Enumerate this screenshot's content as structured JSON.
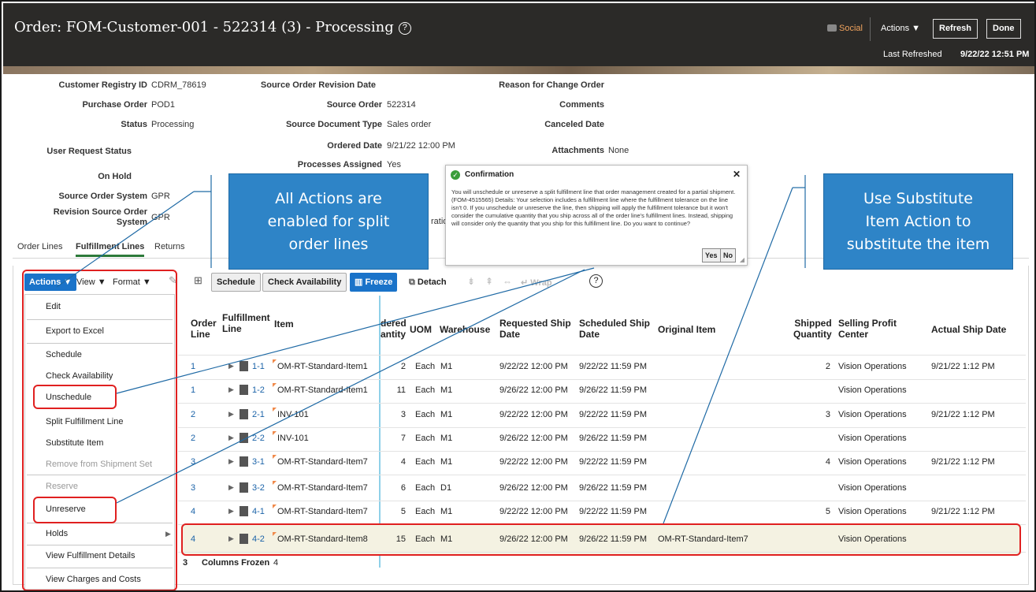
{
  "header": {
    "title": "Order: FOM-Customer-001 - 522314 (3) - Processing",
    "social_label": "Social",
    "actions_label": "Actions ▼",
    "refresh_label": "Refresh",
    "done_label": "Done",
    "last_refreshed_label": "Last Refreshed",
    "last_refreshed_value": "9/22/22 12:51 PM"
  },
  "details": {
    "customer_registry_id_label": "Customer Registry ID",
    "customer_registry_id": "CDRM_78619",
    "purchase_order_label": "Purchase Order",
    "purchase_order": "POD1",
    "status_label": "Status",
    "status": "Processing",
    "user_request_status_label": "User Request Status",
    "on_hold_label": "On Hold",
    "source_order_system_label": "Source Order System",
    "source_order_system": "GPR",
    "revision_source_order_system_label_1": "Revision Source Order",
    "revision_source_order_system_label_2": "System",
    "revision_source_order_system": "GPR",
    "source_order_revision_date_label": "Source Order Revision Date",
    "source_order_label": "Source Order",
    "source_order": "522314",
    "source_document_type_label": "Source Document Type",
    "source_document_type": "Sales order",
    "ordered_date_label": "Ordered Date",
    "ordered_date": "9/21/22 12:00 PM",
    "processes_assigned_label": "Processes Assigned",
    "processes_assigned": "Yes",
    "reason_for_change_order_label": "Reason for Change Order",
    "comments_label": "Comments",
    "canceled_date_label": "Canceled Date",
    "attachments_label": "Attachments",
    "attachments": "None"
  },
  "tabs": [
    "Order Lines",
    "Fulfillment Lines",
    "Returns"
  ],
  "toolbar": {
    "actions": "Actions ▼",
    "view": "View ▼",
    "format": "Format ▼",
    "schedule": "Schedule",
    "check_availability": "Check Availability",
    "freeze": "Freeze",
    "detach": "Detach",
    "wrap": "Wrap"
  },
  "table": {
    "headers": {
      "order_line": [
        "Order",
        "Line"
      ],
      "fulfillment_line": [
        "Fulfillment",
        "Line"
      ],
      "item": "Item",
      "ordered_quantity": [
        "dered",
        "antity"
      ],
      "uom": "UOM",
      "warehouse": "Warehouse",
      "requested_ship_date": [
        "Requested Ship",
        "Date"
      ],
      "scheduled_ship_date": [
        "Scheduled Ship",
        "Date"
      ],
      "original_item": "Original Item",
      "shipped_quantity": [
        "Shipped",
        "Quantity"
      ],
      "selling_profit_center": [
        "Selling Profit",
        "Center"
      ],
      "actual_ship_date": "Actual Ship Date"
    },
    "rows": [
      {
        "order_line": "1",
        "fline": "1-1",
        "item": "OM-RT-Standard-Item1",
        "qty": "2",
        "uom": "Each",
        "wh": "M1",
        "req": "9/22/22 12:00 PM",
        "sched": "9/22/22 11:59 PM",
        "orig": "",
        "shipped": "2",
        "spc": "Vision Operations",
        "actual": "9/21/22 1:12 PM"
      },
      {
        "order_line": "1",
        "fline": "1-2",
        "item": "OM-RT-Standard-Item1",
        "qty": "11",
        "uom": "Each",
        "wh": "M1",
        "req": "9/26/22 12:00 PM",
        "sched": "9/26/22 11:59 PM",
        "orig": "",
        "shipped": "",
        "spc": "Vision Operations",
        "actual": ""
      },
      {
        "order_line": "2",
        "fline": "2-1",
        "item": "INV-101",
        "qty": "3",
        "uom": "Each",
        "wh": "M1",
        "req": "9/22/22 12:00 PM",
        "sched": "9/22/22 11:59 PM",
        "orig": "",
        "shipped": "3",
        "spc": "Vision Operations",
        "actual": "9/21/22 1:12 PM"
      },
      {
        "order_line": "2",
        "fline": "2-2",
        "item": "INV-101",
        "qty": "7",
        "uom": "Each",
        "wh": "M1",
        "req": "9/26/22 12:00 PM",
        "sched": "9/26/22 11:59 PM",
        "orig": "",
        "shipped": "",
        "spc": "Vision Operations",
        "actual": ""
      },
      {
        "order_line": "3",
        "fline": "3-1",
        "item": "OM-RT-Standard-Item7",
        "qty": "4",
        "uom": "Each",
        "wh": "M1",
        "req": "9/22/22 12:00 PM",
        "sched": "9/22/22 11:59 PM",
        "orig": "",
        "shipped": "4",
        "spc": "Vision Operations",
        "actual": "9/21/22 1:12 PM"
      },
      {
        "order_line": "3",
        "fline": "3-2",
        "item": "OM-RT-Standard-Item7",
        "qty": "6",
        "uom": "Each",
        "wh": "D1",
        "req": "9/26/22 12:00 PM",
        "sched": "9/26/22 11:59 PM",
        "orig": "",
        "shipped": "",
        "spc": "Vision Operations",
        "actual": ""
      },
      {
        "order_line": "4",
        "fline": "4-1",
        "item": "OM-RT-Standard-Item7",
        "qty": "5",
        "uom": "Each",
        "wh": "M1",
        "req": "9/22/22 12:00 PM",
        "sched": "9/22/22 11:59 PM",
        "orig": "",
        "shipped": "5",
        "spc": "Vision Operations",
        "actual": "9/21/22 1:12 PM"
      },
      {
        "order_line": "4",
        "fline": "4-2",
        "item": "OM-RT-Standard-Item8",
        "qty": "15",
        "uom": "Each",
        "wh": "M1",
        "req": "9/26/22 12:00 PM",
        "sched": "9/26/22 11:59 PM",
        "orig": "OM-RT-Standard-Item7",
        "shipped": "",
        "spc": "Vision Operations",
        "actual": ""
      }
    ],
    "footer_count": "3",
    "columns_frozen_label": "Columns Frozen",
    "columns_frozen": "4"
  },
  "actions_menu": [
    "Edit",
    "Export to Excel",
    "Schedule",
    "Check Availability",
    "Unschedule",
    "Split Fulfillment Line",
    "Substitute Item",
    "Remove from Shipment Set",
    "Reserve",
    "Unreserve",
    "Holds",
    "View Fulfillment Details",
    "View Charges and Costs"
  ],
  "callouts": {
    "left": [
      "All Actions are",
      "enabled for split",
      "order lines"
    ],
    "right": [
      "Use Substitute",
      "Item Action to",
      "substitute the item"
    ]
  },
  "dialog": {
    "title": "Confirmation",
    "body": "You will unschedule or unreserve a split fulfillment line that order management created for a partial shipment. (FOM-4515565) Details: Your selection includes a fulfillment line where the fulfillment tolerance on the line isn't 0. If you unschedule or unreserve the line, then shipping will apply the fulfillment tolerance but it won't consider the cumulative quantity that you ship across all of the order line's fulfillment lines. Instead, shipping will consider only the quantity that you ship for this fulfillment line. Do you want to continue?",
    "yes": "Yes",
    "no": "No",
    "hidden_field_fragment": "ratio"
  },
  "colors": {
    "header_bg": "#2b2a28",
    "link_blue": "#1b63a8",
    "callout_blue": "#2e84c7",
    "highlight_red": "#e02020",
    "primary_button": "#1a73c9"
  }
}
